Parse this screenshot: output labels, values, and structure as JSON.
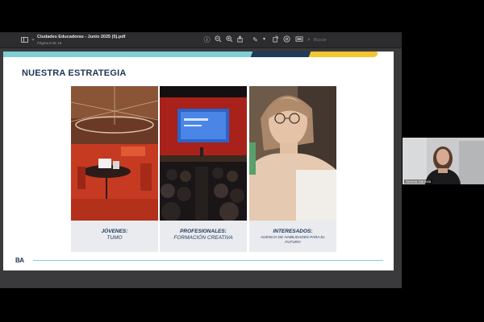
{
  "viewer": {
    "title": "Ciudades Educadoras - Junio 2025 (5).pdf",
    "subtitle": "Página 8 de 15",
    "search_placeholder": "Buscar"
  },
  "toolbar_icons": [
    "info-icon",
    "zoom-out-icon",
    "zoom-in-icon",
    "share-icon",
    "pen-icon",
    "chevron-down-icon",
    "rotate-icon",
    "markup-icon",
    "redact-icon"
  ],
  "slide": {
    "title": "NUESTRA ESTRATEGIA",
    "cards": [
      {
        "heading": "JÓVENES:",
        "text": "TUMO"
      },
      {
        "heading": "PROFESIONALES:",
        "text": "FORMACIÓN CREATIVA"
      },
      {
        "heading": "INTERESADOS:",
        "text": "AGENCIA DE HABILIDADES PARA EL FUTURO"
      }
    ],
    "logo": "BA",
    "colors": {
      "teal": "#7fcfd4",
      "navy": "#203a5a",
      "yellow": "#f5c531",
      "text": "#1e3557"
    }
  },
  "participant": {
    "name": "Serena Saravia"
  }
}
